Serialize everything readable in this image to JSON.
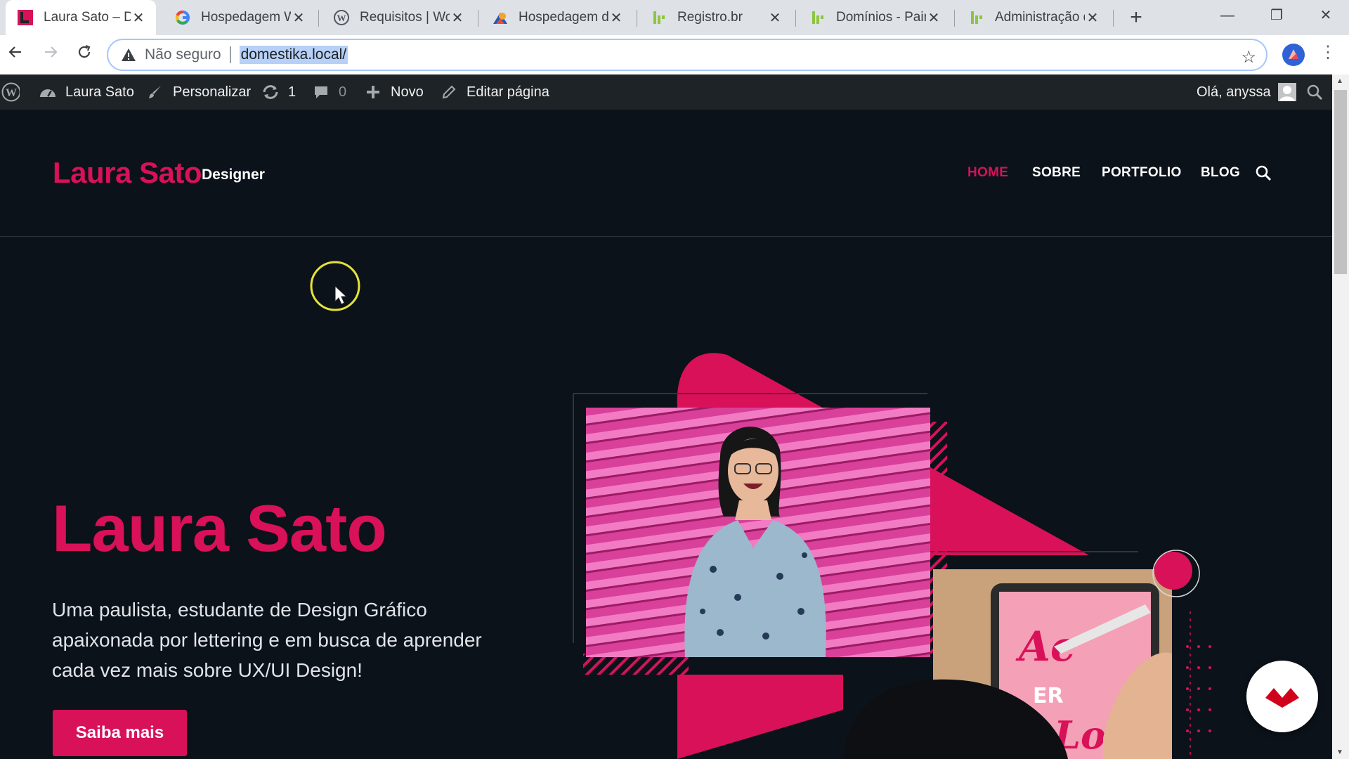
{
  "browser": {
    "tabs": [
      {
        "title": "Laura Sato – De",
        "icon": "laura-sato-favicon"
      },
      {
        "title": "Hospedagem W",
        "icon": "google-icon"
      },
      {
        "title": "Requisitos | Wo",
        "icon": "wordpress-icon"
      },
      {
        "title": "Hospedagem de",
        "icon": "host-icon"
      },
      {
        "title": "Registro.br",
        "icon": "registro-br-icon"
      },
      {
        "title": "Domínios - Pain",
        "icon": "registro-br-icon"
      },
      {
        "title": "Administração d",
        "icon": "registro-br-icon"
      }
    ],
    "address": {
      "security_label": "Não seguro",
      "url": "domestika.local/"
    }
  },
  "admin_bar": {
    "site_name": "Laura Sato",
    "customize": "Personalizar",
    "updates_count": "1",
    "comments_count": "0",
    "new_label": "Novo",
    "edit_page": "Editar página",
    "greeting": "Olá, anyssa"
  },
  "site": {
    "title": "Laura Sato",
    "tagline": "Designer",
    "menu": [
      "HOME",
      "SOBRE",
      "PORTFOLIO",
      "BLOG"
    ],
    "active_menu": "HOME",
    "accent_color": "#d81159",
    "background_color": "#0b1219"
  },
  "hero": {
    "heading": "Laura Sato",
    "text": "Uma paulista, estudante de Design Gráfico apaixonada por lettering e em busca de aprender cada vez mais sobre UX/UI Design!",
    "button_label": "Saiba mais"
  }
}
